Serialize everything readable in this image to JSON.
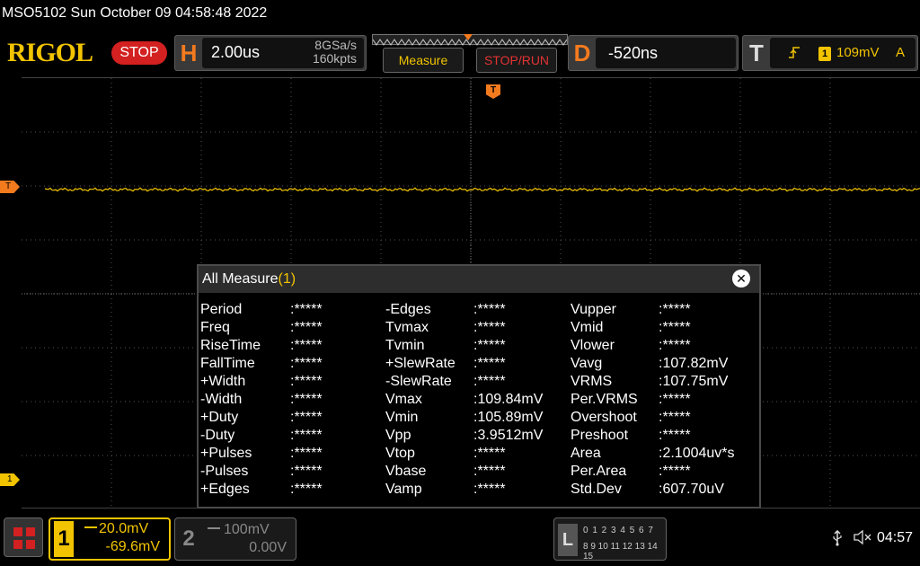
{
  "header": {
    "model_datetime": "MSO5102  Sun October 09 04:58:48 2022",
    "logo": "RIGOL",
    "status": "STOP"
  },
  "horizontal": {
    "letter": "H",
    "timebase": "2.00us",
    "sample_rate": "8GSa/s",
    "memory_depth": "160kpts"
  },
  "buttons": {
    "measure": "Measure",
    "stop_run": "STOP/RUN"
  },
  "delay": {
    "letter": "D",
    "value": "-520ns"
  },
  "trigger": {
    "letter": "T",
    "edge_icon": "rising-edge-icon",
    "source": "1",
    "level": "109mV",
    "mode": "A",
    "marker": "T"
  },
  "measure_dialog": {
    "title": "All Measure",
    "count": "(1)",
    "columns": [
      [
        {
          "name": "Period",
          "value": ":*****"
        },
        {
          "name": "Freq",
          "value": ":*****"
        },
        {
          "name": "RiseTime",
          "value": ":*****"
        },
        {
          "name": "FallTime",
          "value": ":*****"
        },
        {
          "name": "+Width",
          "value": ":*****"
        },
        {
          "name": "-Width",
          "value": ":*****"
        },
        {
          "name": "+Duty",
          "value": ":*****"
        },
        {
          "name": "-Duty",
          "value": ":*****"
        },
        {
          "name": "+Pulses",
          "value": ":*****"
        },
        {
          "name": "-Pulses",
          "value": ":*****"
        },
        {
          "name": "+Edges",
          "value": ":*****"
        }
      ],
      [
        {
          "name": "-Edges",
          "value": ":*****"
        },
        {
          "name": "Tvmax",
          "value": ":*****"
        },
        {
          "name": "Tvmin",
          "value": ":*****"
        },
        {
          "name": "+SlewRate",
          "value": ":*****"
        },
        {
          "name": "-SlewRate",
          "value": ":*****"
        },
        {
          "name": "Vmax",
          "value": ":109.84mV"
        },
        {
          "name": "Vmin",
          "value": ":105.89mV"
        },
        {
          "name": "Vpp",
          "value": ":3.9512mV"
        },
        {
          "name": "Vtop",
          "value": ":*****"
        },
        {
          "name": "Vbase",
          "value": ":*****"
        },
        {
          "name": "Vamp",
          "value": ":*****"
        }
      ],
      [
        {
          "name": "Vupper",
          "value": ":*****"
        },
        {
          "name": "Vmid",
          "value": ":*****"
        },
        {
          "name": "Vlower",
          "value": ":*****"
        },
        {
          "name": "Vavg",
          "value": ":107.82mV"
        },
        {
          "name": "VRMS",
          "value": ":107.75mV"
        },
        {
          "name": "Per.VRMS",
          "value": ":*****"
        },
        {
          "name": "Overshoot",
          "value": ":*****"
        },
        {
          "name": "Preshoot",
          "value": ":*****"
        },
        {
          "name": "Area",
          "value": ":2.1004uv*s"
        },
        {
          "name": "Per.Area",
          "value": ":*****"
        },
        {
          "name": "Std.Dev",
          "value": ":607.70uV"
        }
      ]
    ]
  },
  "channels": {
    "ch1": {
      "number": "1",
      "scale": "20.0mV",
      "offset": "-69.6mV",
      "color": "#f2c400"
    },
    "ch2": {
      "number": "2",
      "scale": "100mV",
      "offset": "0.00V",
      "color": "#888888"
    }
  },
  "logic": {
    "letter": "L",
    "row1": "0 1 2 3  4 5 6 7",
    "row2": "8 9 10 11 12 13 14 15"
  },
  "status_bar": {
    "time": "04:57"
  },
  "colors": {
    "ch1_trace": "#f2c400",
    "trigger": "#f47a1e",
    "stop": "#d32020"
  }
}
